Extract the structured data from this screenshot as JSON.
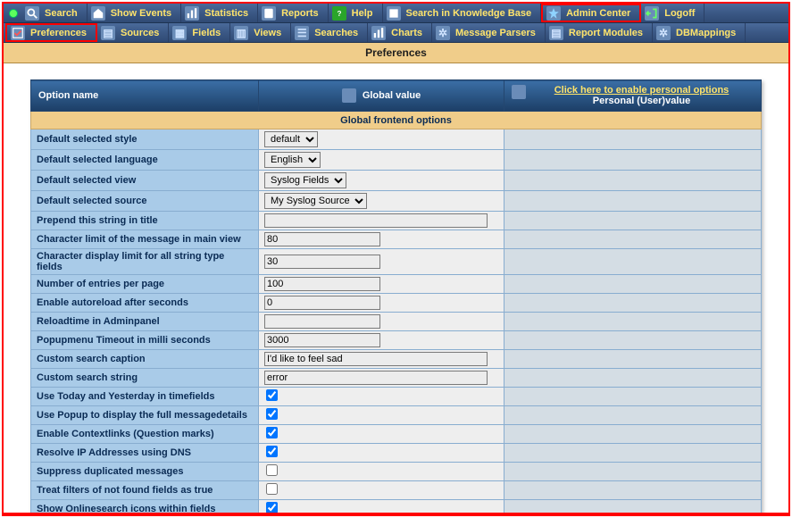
{
  "toolbar1": {
    "search": "Search",
    "showEvents": "Show Events",
    "statistics": "Statistics",
    "reports": "Reports",
    "help": "Help",
    "kb": "Search in Knowledge Base",
    "adminCenter": "Admin Center",
    "logoff": "Logoff"
  },
  "toolbar2": {
    "preferences": "Preferences",
    "sources": "Sources",
    "fields": "Fields",
    "views": "Views",
    "searches": "Searches",
    "charts": "Charts",
    "messageParsers": "Message Parsers",
    "reportModules": "Report Modules",
    "dbmappings": "DBMappings"
  },
  "pageTitle": "Preferences",
  "headers": {
    "optionName": "Option name",
    "globalValue": "Global value",
    "enableLink": "Click here to enable personal options",
    "personalValue": "Personal (User)value"
  },
  "sectionTitle": "Global frontend options",
  "rows": [
    {
      "label": "Default selected style",
      "kind": "select",
      "value": "default",
      "options": [
        "default"
      ]
    },
    {
      "label": "Default selected language",
      "kind": "select",
      "value": "English",
      "options": [
        "English"
      ]
    },
    {
      "label": "Default selected view",
      "kind": "select",
      "value": "Syslog Fields",
      "options": [
        "Syslog Fields"
      ]
    },
    {
      "label": "Default selected source",
      "kind": "select",
      "value": "My Syslog Source",
      "options": [
        "My Syslog Source"
      ]
    },
    {
      "label": "Prepend this string in title",
      "kind": "text",
      "value": "",
      "width": "wide"
    },
    {
      "label": "Character limit of the message in main view",
      "kind": "text",
      "value": "80",
      "width": "narrow"
    },
    {
      "label": "Character display limit for all string type fields",
      "kind": "text",
      "value": "30",
      "width": "narrow"
    },
    {
      "label": "Number of entries per page",
      "kind": "text",
      "value": "100",
      "width": "narrow"
    },
    {
      "label": "Enable autoreload after seconds",
      "kind": "text",
      "value": "0",
      "width": "narrow"
    },
    {
      "label": "Reloadtime in Adminpanel",
      "kind": "text",
      "value": "",
      "width": "narrow"
    },
    {
      "label": "Popupmenu Timeout in milli seconds",
      "kind": "text",
      "value": "3000",
      "width": "narrow"
    },
    {
      "label": "Custom search caption",
      "kind": "text",
      "value": "I'd like to feel sad",
      "width": "wide"
    },
    {
      "label": "Custom search string",
      "kind": "text",
      "value": "error",
      "width": "wide"
    },
    {
      "label": "Use Today and Yesterday in timefields",
      "kind": "check",
      "checked": true
    },
    {
      "label": "Use Popup to display the full messagedetails",
      "kind": "check",
      "checked": true
    },
    {
      "label": "Enable Contextlinks (Question marks)",
      "kind": "check",
      "checked": true
    },
    {
      "label": "Resolve IP Addresses using DNS",
      "kind": "check",
      "checked": true
    },
    {
      "label": "Suppress duplicated messages",
      "kind": "check",
      "checked": false
    },
    {
      "label": "Treat filters of not found fields as true",
      "kind": "check",
      "checked": false
    },
    {
      "label": "Show Onlinesearch icons within fields",
      "kind": "check",
      "checked": true
    }
  ]
}
